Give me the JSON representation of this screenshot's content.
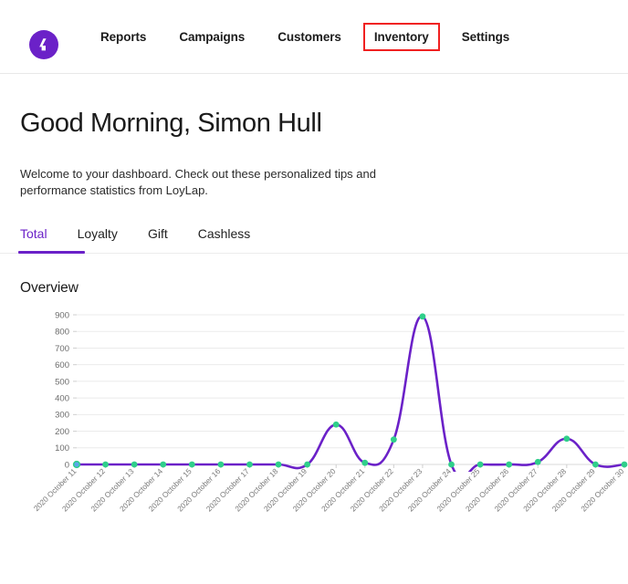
{
  "brand": {
    "logo_icon": "loylap-logo-icon",
    "accent_color": "#6b21c8",
    "highlight_color": "#f02020"
  },
  "nav": {
    "items": [
      {
        "label": "Reports",
        "highlighted": false
      },
      {
        "label": "Campaigns",
        "highlighted": false
      },
      {
        "label": "Customers",
        "highlighted": false
      },
      {
        "label": "Inventory",
        "highlighted": true
      },
      {
        "label": "Settings",
        "highlighted": false
      }
    ]
  },
  "hero": {
    "title": "Good Morning, Simon Hull",
    "welcome": "Welcome to your dashboard. Check out these personalized tips and performance statistics from LoyLap."
  },
  "tabs": {
    "items": [
      {
        "label": "Total",
        "active": true
      },
      {
        "label": "Loyalty",
        "active": false
      },
      {
        "label": "Gift",
        "active": false
      },
      {
        "label": "Cashless",
        "active": false
      }
    ]
  },
  "overview": {
    "heading": "Overview"
  },
  "chart_data": {
    "type": "line",
    "title": "Overview",
    "xlabel": "",
    "ylabel": "",
    "ylim": [
      0,
      900
    ],
    "yticks": [
      0,
      100,
      200,
      300,
      400,
      500,
      600,
      700,
      800,
      900
    ],
    "ytick_labels": [
      "0",
      "100",
      "200",
      "300",
      "400",
      "500",
      "600",
      "700",
      "800",
      "900"
    ],
    "grid": true,
    "legend": false,
    "line_color": "#6b21c8",
    "marker_color": "#2fcf8a",
    "first_marker_color": "#5aa7e8",
    "x_tick_rotation": -45,
    "categories": [
      "2020 October 11",
      "2020 October 12",
      "2020 October 13",
      "2020 October 14",
      "2020 October 15",
      "2020 October 16",
      "2020 October 17",
      "2020 October 18",
      "2020 October 19",
      "2020 October 20",
      "2020 October 21",
      "2020 October 22",
      "2020 October 23",
      "2020 October 24",
      "2020 October 25",
      "2020 October 26",
      "2020 October 27",
      "2020 October 28",
      "2020 October 29",
      "2020 October 30"
    ],
    "values": [
      0,
      0,
      0,
      0,
      0,
      0,
      0,
      0,
      0,
      240,
      10,
      150,
      890,
      0,
      0,
      0,
      15,
      155,
      0,
      0
    ]
  }
}
